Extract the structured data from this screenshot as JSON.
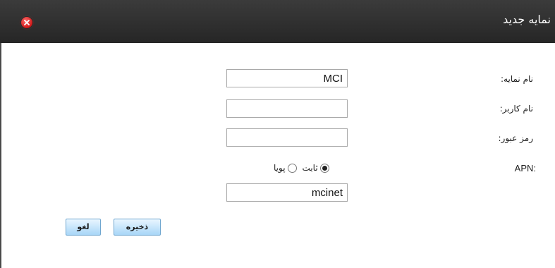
{
  "dialog": {
    "title": "نمایه جدید",
    "close_icon": "close-x-icon"
  },
  "form": {
    "profile_name": {
      "label": "نام نمایه:",
      "value": "MCI"
    },
    "username": {
      "label": "نام کاربر:",
      "value": ""
    },
    "password": {
      "label": "رمز عبور:",
      "value": ""
    },
    "apn": {
      "label": "APN:",
      "options": [
        {
          "label": "ثابت",
          "selected": true
        },
        {
          "label": "پویا",
          "selected": false
        }
      ],
      "value": "mcinet"
    }
  },
  "buttons": {
    "save_label": "ذخیره",
    "cancel_label": "لغو"
  },
  "colors": {
    "titlebar": "#2f2f2f",
    "close_icon": "#d01818",
    "button_gradient_top": "#e9f6ff",
    "button_gradient_bottom": "#a8d6f7"
  }
}
